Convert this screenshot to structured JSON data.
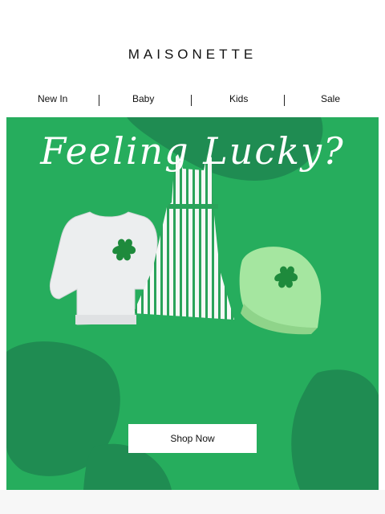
{
  "brand": {
    "name": "MAISONETTE"
  },
  "nav": {
    "items": [
      {
        "label": "New In"
      },
      {
        "label": "Baby"
      },
      {
        "label": "Kids"
      },
      {
        "label": "Sale"
      }
    ]
  },
  "hero": {
    "headline": "Feeling Lucky?",
    "cta_label": "Shop Now",
    "colors": {
      "background": "#26ad5d",
      "shape": "#1f8c52",
      "text": "#ffffff"
    }
  }
}
